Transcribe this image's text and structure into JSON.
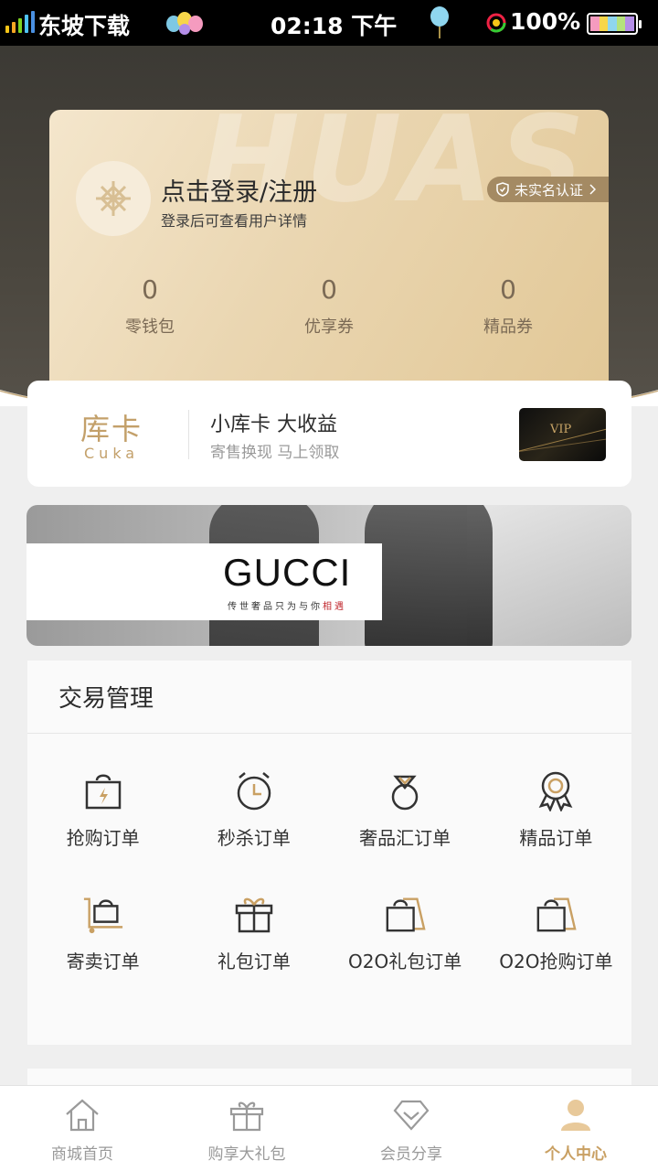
{
  "status_bar": {
    "carrier": "东坡下载",
    "time": "02:18 下午",
    "battery_percent": "100%"
  },
  "member_card": {
    "watermark": "HUAS",
    "login_title": "点击登录/注册",
    "login_subtitle": "登录后可查看用户详情",
    "verify_badge": "未实名认证",
    "stats": [
      {
        "value": "0",
        "label": "零钱包"
      },
      {
        "value": "0",
        "label": "优享券"
      },
      {
        "value": "0",
        "label": "精品券"
      }
    ]
  },
  "cuka": {
    "logo_cn": "库卡",
    "logo_en": "Cuka",
    "title": "小库卡  大收益",
    "subtitle": "寄售换现  马上领取",
    "vip_text": "VIP"
  },
  "banner": {
    "brand": "GUCCI",
    "tagline_main": "传世奢品只为与你",
    "tagline_highlight": "相遇"
  },
  "transaction": {
    "title": "交易管理",
    "items": [
      {
        "label": "抢购订单",
        "icon": "shopping-bag-bolt-icon"
      },
      {
        "label": "秒杀订单",
        "icon": "alarm-clock-icon"
      },
      {
        "label": "奢品汇订单",
        "icon": "diamond-ring-icon"
      },
      {
        "label": "精品订单",
        "icon": "award-medal-icon"
      },
      {
        "label": "寄卖订单",
        "icon": "trolley-bag-icon"
      },
      {
        "label": "礼包订单",
        "icon": "gift-box-icon"
      },
      {
        "label": "O2O礼包订单",
        "icon": "double-bag-icon"
      },
      {
        "label": "O2O抢购订单",
        "icon": "double-bag-icon"
      }
    ]
  },
  "bottom_nav": [
    {
      "label": "商城首页",
      "icon": "home-icon",
      "active": false
    },
    {
      "label": "购享大礼包",
      "icon": "gift-icon",
      "active": false
    },
    {
      "label": "会员分享",
      "icon": "diamond-share-icon",
      "active": false
    },
    {
      "label": "个人中心",
      "icon": "user-icon",
      "active": true
    }
  ],
  "colors": {
    "gold_accent": "#c9a063",
    "card_gold": "#ead6b1",
    "header_dark": "#3a3833"
  }
}
